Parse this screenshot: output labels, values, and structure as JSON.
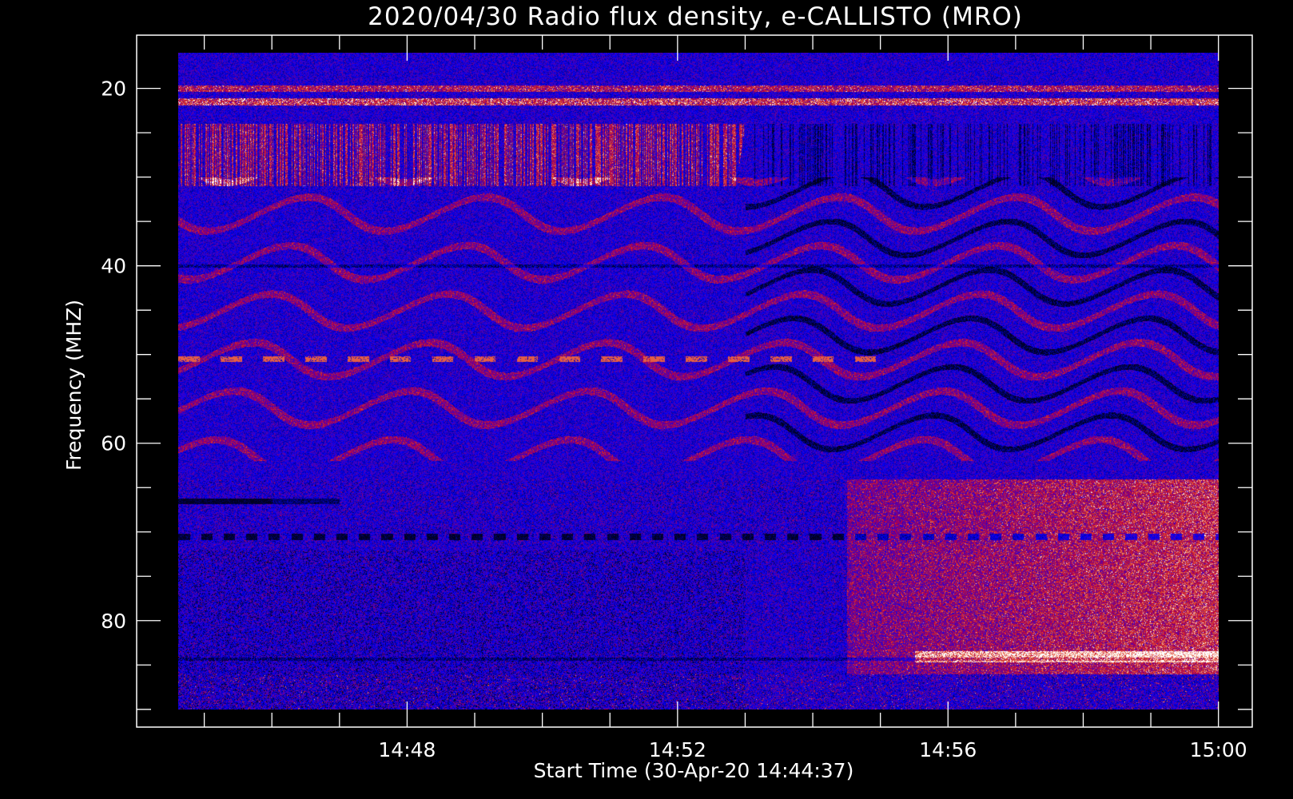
{
  "chart_data": {
    "type": "heatmap",
    "title": "2020/04/30  Radio flux density, e-CALLISTO (MRO)",
    "xlabel": "Start Time (30-Apr-20 14:44:37)",
    "ylabel": "Frequency (MHZ)",
    "x_start": "14:44:37",
    "x_end": "15:00:00",
    "xlim": [
      "14:44:00",
      "15:00:30"
    ],
    "ylim": [
      92,
      14
    ],
    "y_data_range": [
      16,
      90
    ],
    "x_major_ticks": [
      "14:48",
      "14:52",
      "14:56",
      "15:00"
    ],
    "y_major_ticks": [
      20,
      40,
      60,
      80
    ],
    "y_minor_step": 5,
    "x_minor_step_minutes": 1,
    "colormap": [
      "#000000",
      "#0000ff",
      "#c01010",
      "#ffffff"
    ],
    "background_color": "#000000",
    "foreground_color": "#ffffff",
    "features": [
      {
        "kind": "band",
        "freq": 20,
        "time_range": [
          "14:44:37",
          "15:00:00"
        ],
        "intensity": "high",
        "color": "#ff3010"
      },
      {
        "kind": "band",
        "freq": 21.5,
        "time_range": [
          "14:44:37",
          "15:00:00"
        ],
        "intensity": "high",
        "color": "#ff6020"
      },
      {
        "kind": "region",
        "freq_range": [
          24,
          31
        ],
        "time_range": [
          "14:44:37",
          "14:53:00"
        ],
        "intensity": "high",
        "pattern": "vertical-stripes"
      },
      {
        "kind": "dashed-band",
        "freq": 50.5,
        "time_range": [
          "14:44:37",
          "14:55:00"
        ],
        "color": "#ff2010"
      },
      {
        "kind": "dark-line",
        "freq": 66.5,
        "time_range": [
          "14:44:37",
          "14:47:00"
        ]
      },
      {
        "kind": "dashed-band",
        "freq": 70.5,
        "time_range": [
          "14:44:37",
          "15:00:00"
        ],
        "color": "#000000"
      },
      {
        "kind": "region",
        "freq_range": [
          68,
          86
        ],
        "time_range": [
          "14:55:00",
          "15:00:00"
        ],
        "intensity": "medium",
        "color": "#d03018"
      },
      {
        "kind": "band",
        "freq": 84,
        "time_range": [
          "14:55:30",
          "15:00:00"
        ],
        "intensity": "medium",
        "color": "#ff5020"
      }
    ]
  }
}
